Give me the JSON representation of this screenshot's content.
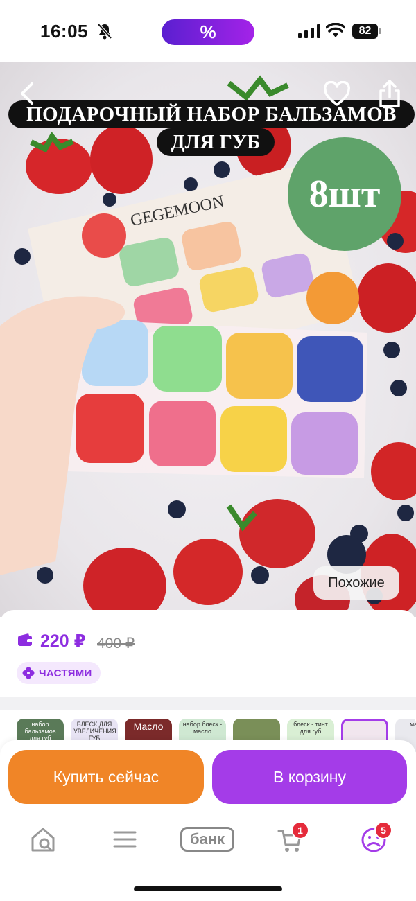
{
  "status_bar": {
    "time": "16:05",
    "center_badge": "%",
    "battery": "82"
  },
  "product": {
    "image_title_line1": "ПОДАРОЧНЫЙ НАБОР БАЛЬЗАМОВ",
    "image_title_line2": "ДЛЯ ГУБ",
    "count_badge": "8шт",
    "brand": "GEGEMOON",
    "similar_label": "Похожие"
  },
  "price": {
    "current": "220 ₽",
    "old": "400 ₽",
    "installments_label": "ЧАСТЯМИ"
  },
  "variants": [
    {
      "label": "набор бальзамов для губ"
    },
    {
      "label": "БЛЕСК ДЛЯ УВЕЛИЧЕНИЯ ГУБ"
    },
    {
      "label": "Масло"
    },
    {
      "label": "набор блеск - масло"
    },
    {
      "label": ""
    },
    {
      "label": "блеск - тинт для губ"
    },
    {
      "label": ""
    },
    {
      "label": "масло"
    }
  ],
  "actions": {
    "buy_now": "Купить сейчас",
    "add_to_cart": "В корзину"
  },
  "tabbar": {
    "bank_label": "банк",
    "cart_count": "1",
    "profile_count": "5"
  },
  "colors": {
    "accent": "#a43ce8",
    "buy": "#f08527",
    "price": "#8d2de0",
    "badge_green": "#5fa36a"
  }
}
